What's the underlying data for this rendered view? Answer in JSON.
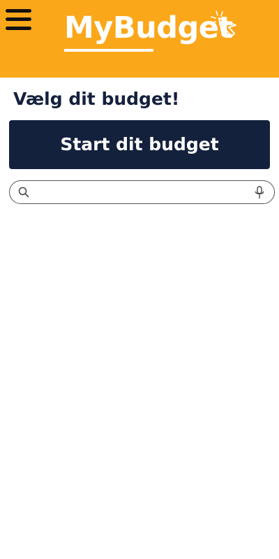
{
  "header": {
    "logo_text": "MyBudget",
    "menu_icon": "hamburger-menu-icon",
    "cursor_icon": "click-cursor-icon",
    "background_color": "#FBA71A"
  },
  "main": {
    "title": "Vælg dit budget!",
    "start_button_label": "Start dit budget",
    "accent_color": "#14213D"
  },
  "search": {
    "value": "",
    "placeholder": "",
    "search_icon": "search-icon",
    "mic_icon": "microphone-icon"
  }
}
